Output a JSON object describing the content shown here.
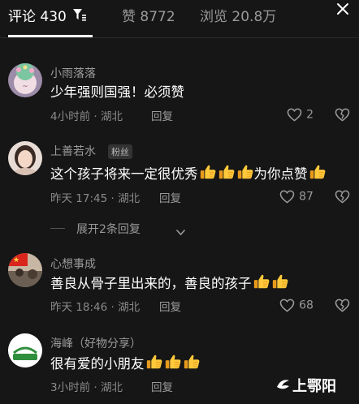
{
  "tabs": {
    "comments_label": "评论",
    "comments_count": "430",
    "likes_label": "赞",
    "likes_count": "8772",
    "views_label": "浏览",
    "views_count": "20.8万"
  },
  "icons": {
    "filter": "filter-icon",
    "close": "close-icon",
    "like": "heart-outline-icon",
    "dislike": "broken-heart-icon",
    "expand": "chevron-down-icon",
    "thumbs": "thumbs-up-emoji"
  },
  "colors": {
    "background": "#161616",
    "primary_text": "#ffffff",
    "secondary_text": "#9a9a9a"
  },
  "comments": [
    {
      "username": "小雨落落",
      "text": "少年强则国强！必须赞",
      "time": "4小时前",
      "location": "湖北",
      "reply_label": "回复",
      "likes": "2",
      "thumbs": 0
    },
    {
      "username": "上善若水",
      "badge": "粉丝",
      "text_before": "这个孩子将来一定很优秀",
      "thumbs_before": 3,
      "text_after": "为你点赞",
      "thumbs_after": 1,
      "time": "昨天 17:45",
      "location": "湖北",
      "reply_label": "回复",
      "likes": "87"
    },
    {
      "username": "心想事成",
      "text": "善良从骨子里出来的，善良的孩子",
      "thumbs": 2,
      "time": "昨天 18:46",
      "location": "湖北",
      "reply_label": "回复",
      "likes": "68"
    },
    {
      "username": "海峰（好物分享）",
      "avatar_text": "海峰好物",
      "text": "很有爱的小朋友",
      "thumbs": 3,
      "time": "3小时前",
      "location": "湖北",
      "reply_label": "回复"
    }
  ],
  "expand_replies": "展开2条回复",
  "watermark": "上鄂阳"
}
